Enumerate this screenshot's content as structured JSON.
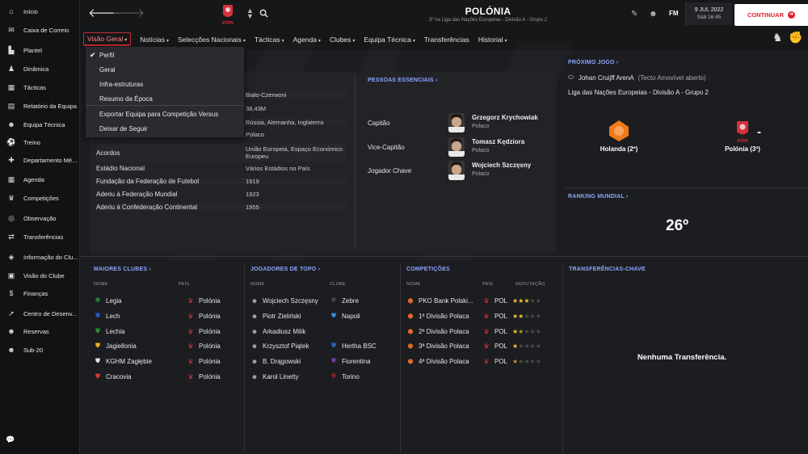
{
  "sidebar": {
    "items": [
      {
        "label": "Início",
        "icon": "home-icon",
        "glyph": "⌂"
      },
      {
        "label": "Caixa de Correio",
        "icon": "inbox-icon",
        "glyph": "✉"
      },
      {
        "label": "Plantel",
        "icon": "shirt-icon",
        "glyph": "▙"
      },
      {
        "label": "Dinâmica",
        "icon": "dynamics-icon",
        "glyph": "♟"
      },
      {
        "label": "Tácticas",
        "icon": "tactics-icon",
        "glyph": "▦"
      },
      {
        "label": "Relatório da Equipa",
        "icon": "report-icon",
        "glyph": "▤"
      },
      {
        "label": "Equipa Técnica",
        "icon": "staff-icon",
        "glyph": "☻"
      },
      {
        "label": "Treino",
        "icon": "training-icon",
        "glyph": "⚽"
      },
      {
        "label": "Departamento Mé...",
        "icon": "medical-icon",
        "glyph": "✚"
      },
      {
        "label": "Agenda",
        "icon": "calendar-icon",
        "glyph": "▦"
      },
      {
        "label": "Competições",
        "icon": "trophy-icon",
        "glyph": "♛"
      },
      {
        "label": "Observação",
        "icon": "scouting-icon",
        "glyph": "◎"
      },
      {
        "label": "Transferências",
        "icon": "transfers-icon",
        "glyph": "⇄"
      },
      {
        "label": "Informação do Clu...",
        "icon": "club-info-icon",
        "glyph": "◈"
      },
      {
        "label": "Visão do Clube",
        "icon": "club-vision-icon",
        "glyph": "▣"
      },
      {
        "label": "Finanças",
        "icon": "finances-icon",
        "glyph": "$"
      },
      {
        "label": "Centro de Desenv...",
        "icon": "development-icon",
        "glyph": "➚"
      },
      {
        "label": "Reservas",
        "icon": "reserves-icon",
        "glyph": "☻"
      },
      {
        "label": "Sub-20",
        "icon": "u20-icon",
        "glyph": "☻"
      }
    ]
  },
  "header": {
    "title": "POLÓNIA",
    "subtitle": "3º na Liga das Nações Europeias - Divisão A - Grupo 2",
    "date": "9 JUL 2022",
    "day_time": "Sáb 16:45",
    "continue_label": "CONTINUAR",
    "fm_label": "FM"
  },
  "tabs": [
    {
      "label": "Visão Geral",
      "active": true
    },
    {
      "label": "Notícias",
      "active": false
    },
    {
      "label": "Selecções Nacionais",
      "active": false
    },
    {
      "label": "Tácticas",
      "active": false
    },
    {
      "label": "Agenda",
      "active": false
    },
    {
      "label": "Clubes",
      "active": false
    },
    {
      "label": "Equipa Técnica",
      "active": false
    },
    {
      "label": "Transferências",
      "active": false,
      "no_chevron": true
    },
    {
      "label": "Historial",
      "active": false
    }
  ],
  "dropdown": {
    "items": [
      "Perfil",
      "Geral",
      "Infra-estruturas",
      "Resumo da Época",
      "Exportar Equipa para Competição Versus",
      "Deixar de Seguir"
    ],
    "checked": "Perfil"
  },
  "profile": {
    "rows": [
      {
        "k": "",
        "v": "Biało-Czerwoni"
      },
      {
        "k": "",
        "v": "38,43M"
      },
      {
        "k": "Países Rivais",
        "v": "Rússia, Alemanha, Inglaterra"
      },
      {
        "k": "Idioma(s)",
        "v": "Polaco"
      },
      {
        "k": "Acordos",
        "v": "União Europeia, Espaço Económico Europeu"
      },
      {
        "k": "Estádio Nacional",
        "v": "Vários Estádios no País"
      },
      {
        "k": "Fundação da Federação de Futebol",
        "v": "1919"
      },
      {
        "k": "Aderiu à Federação Mundial",
        "v": "1923"
      },
      {
        "k": "Aderiu à Confederação Continental",
        "v": "1955"
      }
    ]
  },
  "key_people": {
    "title": "PESSOAS ESSENCIAIS",
    "people": [
      {
        "role": "Capitão",
        "name": "Grzegorz Krychowiak",
        "nationality": "Polaco"
      },
      {
        "role": "Vice-Capitão",
        "name": "Tomasz Kędziora",
        "nationality": "Polaco"
      },
      {
        "role": "Jogador Chave",
        "name": "Wojciech Szczęsny",
        "nationality": "Polaco"
      }
    ]
  },
  "next_match": {
    "title": "PRÓXIMO JOGO",
    "stadium": "Johan Cruijff ArenA",
    "roof": "(Tecto Amovível aberto)",
    "competition": "Liga das Nações Europeias - Divisão A - Grupo 2",
    "home": "Holanda (2º)",
    "away": "Polónia (3º)",
    "separator": "-"
  },
  "world_ranking": {
    "title": "RANKING MUNDIAL",
    "value": "26º"
  },
  "biggest_clubs": {
    "title": "MAIORES CLUBES",
    "col_name": "NOME",
    "col_country": "PAÍS",
    "rows": [
      {
        "name": "Legia",
        "country": "Polónia",
        "badge": "#1f7a3a"
      },
      {
        "name": "Lech",
        "country": "Polónia",
        "badge": "#2456c8"
      },
      {
        "name": "Lechia",
        "country": "Polónia",
        "badge": "#2c8a3a"
      },
      {
        "name": "Jagiellonia",
        "country": "Polónia",
        "badge": "#e2b21a"
      },
      {
        "name": "KGHM Zagłębie",
        "country": "Polónia",
        "badge": "#e5e5e5"
      },
      {
        "name": "Cracovia",
        "country": "Polónia",
        "badge": "#d33"
      }
    ]
  },
  "top_players": {
    "title": "JOGADORES DE TOPO",
    "col_name": "NOME",
    "col_club": "CLUBE",
    "rows": [
      {
        "name": "Wojciech Szczęsny",
        "club": "Zebre",
        "badge": "#444"
      },
      {
        "name": "Piotr Zieliński",
        "club": "Napoli",
        "badge": "#2d8fe0"
      },
      {
        "name": "Arkadiusz Milik",
        "club": "",
        "badge": ""
      },
      {
        "name": "Krzysztof Piątek",
        "club": "Hertha BSC",
        "badge": "#2a63b8"
      },
      {
        "name": "B. Drągowski",
        "club": "Fiorentina",
        "badge": "#6a3aa3"
      },
      {
        "name": "Karol Linetty",
        "club": "Torino",
        "badge": "#8b1d25"
      }
    ]
  },
  "competitions": {
    "title": "COMPETIÇÕES",
    "col_name": "NOME",
    "col_country": "PAÍS",
    "col_rep": "REPUTAÇÃO",
    "rows": [
      {
        "name": "PKO Bank Polski...",
        "country": "POL",
        "rep": 3,
        "half": false
      },
      {
        "name": "1ª Divisão Polaca",
        "country": "POL",
        "rep": 2,
        "half": false
      },
      {
        "name": "2ª Divisão Polaca",
        "country": "POL",
        "rep": 1,
        "half": true
      },
      {
        "name": "3ª Divisão Polaca",
        "country": "POL",
        "rep": 1,
        "half": false
      },
      {
        "name": "4ª Divisão Polaca",
        "country": "POL",
        "rep": 0,
        "half": true
      }
    ]
  },
  "key_transfers": {
    "title": "TRANSFERÊNCIAS-CHAVE",
    "empty": "Nenhuma Transferência."
  },
  "colors": {
    "accent_red": "#e0202c",
    "link_blue": "#8ca5ff",
    "star": "#f2c230",
    "flag_red": "#d6303a"
  }
}
